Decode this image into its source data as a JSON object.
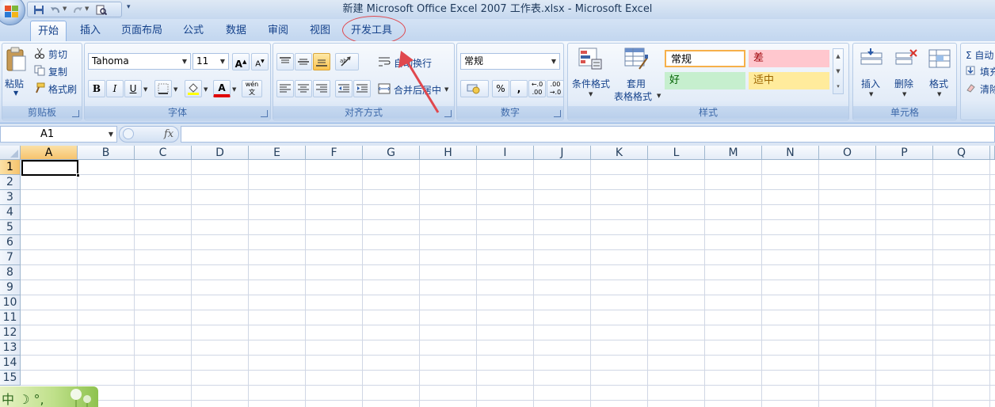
{
  "window": {
    "title": "新建 Microsoft Office Excel 2007 工作表.xlsx - Microsoft Excel"
  },
  "tabs": [
    "开始",
    "插入",
    "页面布局",
    "公式",
    "数据",
    "审阅",
    "视图",
    "开发工具"
  ],
  "active_tab": "开始",
  "ribbon": {
    "clipboard": {
      "label": "剪贴板",
      "paste": "粘贴",
      "cut": "剪切",
      "copy": "复制",
      "format_painter": "格式刷"
    },
    "font": {
      "label": "字体",
      "font_name": "Tahoma",
      "font_size": "11",
      "bold": "B",
      "italic": "I",
      "underline": "U",
      "font_color": "A",
      "phonetic": "wén 文"
    },
    "alignment": {
      "label": "对齐方式",
      "wrap_text": "自动换行",
      "merge_center": "合并后居中"
    },
    "number": {
      "label": "数字",
      "format": "常规",
      "percent": "%",
      "comma": ","
    },
    "styles": {
      "label": "样式",
      "conditional_formatting": "条件格式",
      "format_as_table_1": "套用",
      "format_as_table_2": "表格格式",
      "cells": [
        {
          "text": "常规",
          "bg": "#ffffff",
          "fg": "#000000"
        },
        {
          "text": "差",
          "bg": "#ffc7ce",
          "fg": "#9c0006"
        },
        {
          "text": "好",
          "bg": "#c6efce",
          "fg": "#006100"
        },
        {
          "text": "适中",
          "bg": "#ffeb9c",
          "fg": "#9c6500"
        }
      ]
    },
    "cells_group": {
      "label": "单元格",
      "insert": "插入",
      "delete": "删除",
      "format": "格式"
    },
    "editing": {
      "autosum": "Σ 自动",
      "fill": "填充",
      "clear": "清除"
    }
  },
  "formula_bar": {
    "name_box": "A1",
    "fx": "fx",
    "content": ""
  },
  "grid": {
    "columns": [
      "A",
      "B",
      "C",
      "D",
      "E",
      "F",
      "G",
      "H",
      "I",
      "J",
      "K",
      "L",
      "M",
      "N",
      "O",
      "P",
      "Q"
    ],
    "rows": [
      "1",
      "2",
      "3",
      "4",
      "5",
      "6",
      "7",
      "8",
      "9",
      "10",
      "11",
      "12",
      "13",
      "14",
      "15"
    ],
    "selected_cell": "A1"
  },
  "ime": {
    "text": "中 ☽ °,"
  },
  "colors": {
    "annotation": "#e0484e",
    "ribbon_text": "#15428b"
  }
}
